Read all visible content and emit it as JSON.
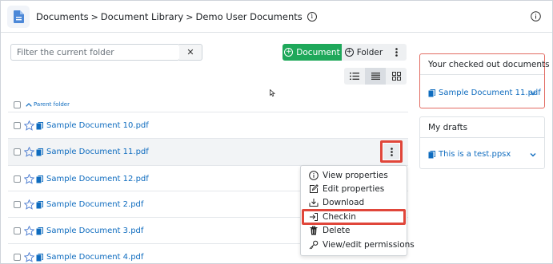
{
  "header": {
    "breadcrumb": [
      "Documents",
      "Document Library",
      "Demo User Documents"
    ],
    "separator": ">"
  },
  "toolbar": {
    "filter_placeholder": "Filter the current folder",
    "clear_label": "✕",
    "document_label": "Document",
    "folder_label": "Folder"
  },
  "list": {
    "parent_folder_label": "Parent folder",
    "files": [
      "Sample Document 10.pdf",
      "Sample Document 11.pdf",
      "Sample Document 12.pdf",
      "Sample Document 2.pdf",
      "Sample Document 3.pdf",
      "Sample Document 4.pdf"
    ]
  },
  "menu": {
    "items": [
      "View properties",
      "Edit properties",
      "Download",
      "Checkin",
      "Delete",
      "View/edit permissions"
    ]
  },
  "panels": {
    "checked_out": {
      "title": "Your checked out documents",
      "file": "Sample Document 11.pdf"
    },
    "drafts": {
      "title": "My drafts",
      "file": "This is a test.ppsx"
    }
  },
  "colors": {
    "accent_green": "#1ea85a",
    "link_blue": "#0f6cbf",
    "highlight_red": "#e0463a"
  }
}
